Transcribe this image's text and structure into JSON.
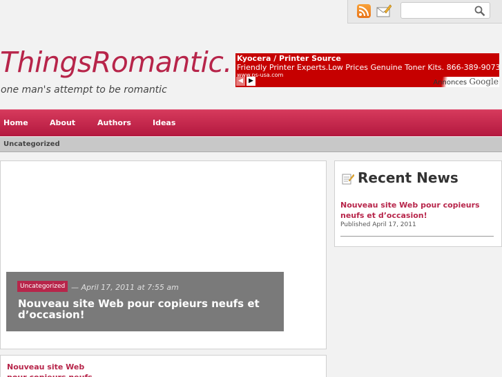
{
  "topbar": {
    "search_placeholder": ""
  },
  "header": {
    "site_title": "ThingsRomantic.",
    "tagline": "one man's attempt to be romantic"
  },
  "ad": {
    "title": "Kyocera / Printer Source",
    "text": "Friendly Printer Experts.Low Prices Genuine Toner Kits. 866-389-9073",
    "url": "www.ps-usa.com",
    "prev": "◀",
    "next": "▶",
    "annonces": "Annonces",
    "google": "Google"
  },
  "nav": {
    "items": [
      "Home",
      "About",
      "Authors",
      "Ideas"
    ]
  },
  "subnav": {
    "category": "Uncategorized"
  },
  "feature": {
    "category": "Uncategorized",
    "date": "— April 17, 2011 at 7:55 am",
    "title": "Nouveau site Web pour copieurs neufs et d’occasion!"
  },
  "post": {
    "title": "Nouveau site Web pour copieurs neufs"
  },
  "sidebar": {
    "heading": "Recent News",
    "link": "Nouveau site Web pour copieurs neufs et d’occasion!",
    "published": "Published April 17, 2011"
  },
  "colors": {
    "accent": "#b7254a",
    "ad_bg": "#c60000",
    "feature_bg": "#7a7a7a"
  },
  "icons": [
    "rss-icon",
    "mail-icon",
    "search-icon",
    "news-icon"
  ]
}
